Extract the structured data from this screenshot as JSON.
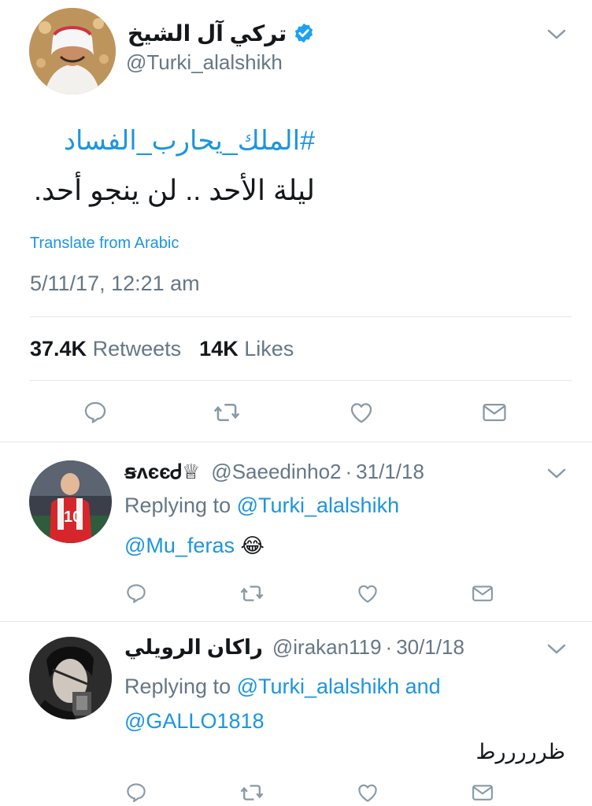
{
  "main_tweet": {
    "display_name": "تركي آل الشيخ",
    "handle": "@Turki_alalshikh",
    "hashtag": "#الملك_يحارب_الفساد",
    "text": "ليلة الأحد .. لن ينجو أحد.",
    "translate_label": "Translate from Arabic",
    "timestamp": "5/11/17, 12:21 am",
    "retweets_count": "37.4K",
    "retweets_label": "Retweets",
    "likes_count": "14K",
    "likes_label": "Likes"
  },
  "replies": [
    {
      "display_name": "ꞩᴧєєᏧ♕",
      "handle": "@Saeedinho2",
      "dot": "·",
      "date": "31/1/18",
      "replying_prefix": "Replying to",
      "replying_to": "@Turki_alalshikh",
      "text": "@Mu_feras",
      "emoji": "😂"
    },
    {
      "display_name": "راكان الرويلي",
      "handle": "@irakan119",
      "dot": "·",
      "date": "30/1/18",
      "replying_prefix": "Replying to",
      "replying_to": "@Turki_alalshikh",
      "replying_and": "and",
      "replying_to_2": "@GALLO1818",
      "text": "ظرررررط"
    }
  ],
  "colors": {
    "link": "#1b95e0",
    "muted": "#657786",
    "verified": "#1da1f2",
    "divider": "#e1e8ed"
  },
  "icons": [
    "verified-badge-icon",
    "chevron-down-icon",
    "reply-icon",
    "retweet-icon",
    "like-icon",
    "dm-icon"
  ]
}
